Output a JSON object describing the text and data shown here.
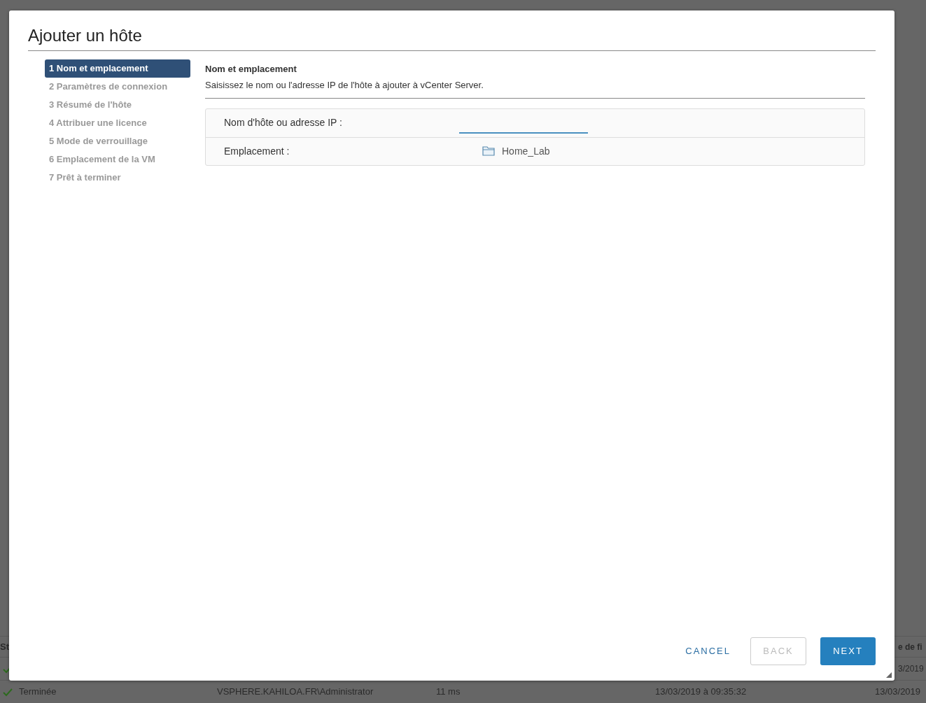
{
  "background_table": {
    "header": {
      "column_1": "St",
      "column_5": "e de fi"
    },
    "rows": [
      {
        "done": true,
        "column_5": "3/2019"
      },
      {
        "done": true,
        "column_1": "Terminée",
        "column_2": "VSPHERE.KAHILOA.FR\\Administrator",
        "column_3": "11 ms",
        "column_4": "13/03/2019 à 09:35:32",
        "column_5": "13/03/2019"
      }
    ]
  },
  "dialog": {
    "title": "Ajouter un hôte",
    "steps": [
      {
        "label": "1 Nom et emplacement",
        "selected": true
      },
      {
        "label": "2 Paramètres de connexion",
        "selected": false
      },
      {
        "label": "3 Résumé de l'hôte",
        "selected": false
      },
      {
        "label": "4 Attribuer une licence",
        "selected": false
      },
      {
        "label": "5 Mode de verrouillage",
        "selected": false
      },
      {
        "label": "6 Emplacement de la VM",
        "selected": false
      },
      {
        "label": "7 Prêt à terminer",
        "selected": false
      }
    ],
    "section": {
      "heading": "Nom et emplacement",
      "description": "Saisissez le nom ou l'adresse IP de l'hôte à ajouter à vCenter Server."
    },
    "fields": [
      {
        "kind": "input",
        "label": "Nom d'hôte ou adresse IP :"
      },
      {
        "kind": "folder",
        "label": "Emplacement :",
        "value": "Home_Lab"
      }
    ],
    "buttons": [
      {
        "kind": "link",
        "label": "CANCEL",
        "disabled": false
      },
      {
        "kind": "outline",
        "label": "BACK",
        "disabled": true
      },
      {
        "kind": "primary",
        "label": "NEXT",
        "disabled": false
      }
    ]
  }
}
